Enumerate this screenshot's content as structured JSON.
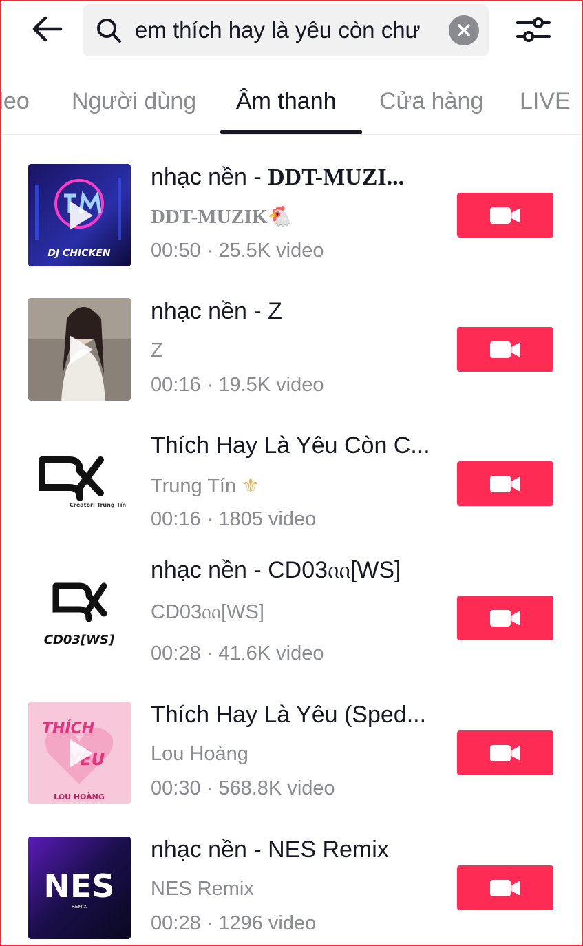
{
  "search": {
    "query": "em thích hay là yêu còn chư"
  },
  "tabs": [
    {
      "label": "deo"
    },
    {
      "label": "Người dùng"
    },
    {
      "label": "Âm thanh"
    },
    {
      "label": "Cửa hàng"
    },
    {
      "label": "LIVE"
    }
  ],
  "active_tab": "Âm thanh",
  "sounds": [
    {
      "title_prefix": "nhạc nền - ",
      "title_suffix": "DDT-MUZI...",
      "author": "DDT-MUZIK",
      "author_emoji": "🐔",
      "meta": "00:50 · 25.5K video",
      "thumb_text": "DJ CHICKEN"
    },
    {
      "title_prefix": "nhạc nền - Z",
      "title_suffix": "",
      "author": "Z",
      "author_emoji": "",
      "meta": "00:16 · 19.5K video",
      "thumb_text": ""
    },
    {
      "title_prefix": "Thích Hay Là Yêu Còn C...",
      "title_suffix": "",
      "author": "Trung Tín",
      "author_emoji": "⚜",
      "meta": "00:16 · 1805 video",
      "thumb_text": "Creator: Trung Tín"
    },
    {
      "title_prefix": "nhạc nền - CD03ᦶ[WS]",
      "title_suffix": "",
      "author": "CD03ᦶ[WS]",
      "author_emoji": "",
      "meta": "00:28 · 41.6K video",
      "thumb_text": "CD03[WS]"
    },
    {
      "title_prefix": "Thích Hay Là Yêu (Sped...",
      "title_suffix": "",
      "author": "Lou Hoàng",
      "author_emoji": "",
      "meta": "00:30 · 568.8K video",
      "thumb_text": "LOU HOÀNG"
    },
    {
      "title_prefix": "nhạc nền - NES Remix",
      "title_suffix": "",
      "author": "NES Remix",
      "author_emoji": "",
      "meta": "00:28 · 1296 video",
      "thumb_text": "NES"
    }
  ],
  "colors": {
    "accent": "#fe2c55",
    "text_primary": "#161823",
    "text_secondary": "#8a8b91"
  },
  "icons": {
    "back": "arrow-left-icon",
    "search": "search-icon",
    "clear": "clear-icon",
    "filter": "filter-sliders-icon",
    "use_sound": "video-camera-icon",
    "play": "play-icon"
  }
}
